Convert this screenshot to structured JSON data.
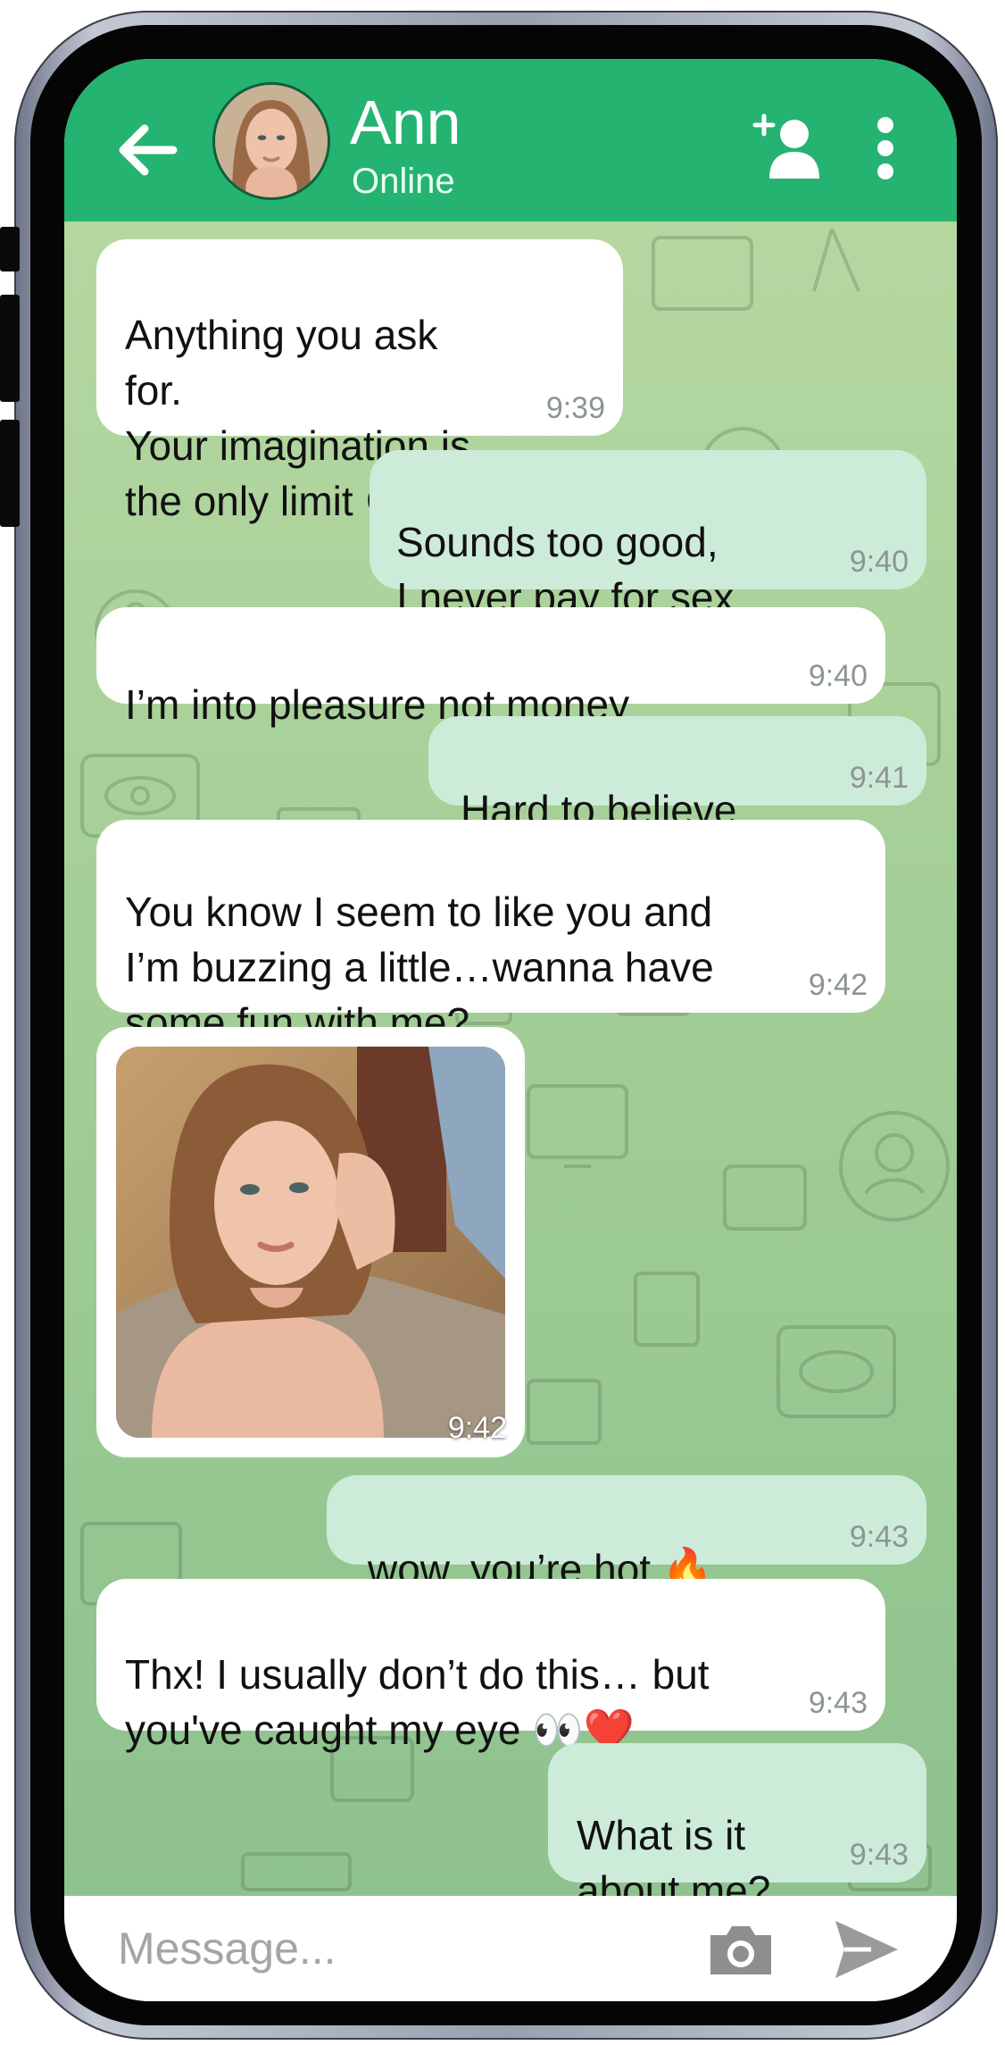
{
  "header": {
    "contact_name": "Ann",
    "status": "Online",
    "back_icon": "back-arrow-icon",
    "add_contact_icon": "add-contact-icon",
    "more_icon": "more-vertical-icon"
  },
  "messages": [
    {
      "direction": "in",
      "text": "Anything you ask for.\nYour imagination is\nthe only limit 😉",
      "time": "9:39"
    },
    {
      "direction": "out",
      "text": "Sounds too good,\nI never pay for sex",
      "time": "9:40"
    },
    {
      "direction": "in",
      "text": "I’m into pleasure not money",
      "time": "9:40"
    },
    {
      "direction": "out",
      "text": "Hard to believe",
      "time": "9:41"
    },
    {
      "direction": "in",
      "text": "You know I seem to like you and\nI’m buzzing a little…wanna have\nsome fun with me?",
      "time": "9:42"
    },
    {
      "direction": "in",
      "type": "photo",
      "time": "9:42"
    },
    {
      "direction": "out",
      "text": "wow, you’re hot 🔥",
      "time": "9:43"
    },
    {
      "direction": "in",
      "text": "Thx! I usually don’t do this… but\nyou've caught my eye 👀❤️",
      "time": "9:43"
    },
    {
      "direction": "out",
      "text": "What is it\nabout me?",
      "time": "9:43"
    }
  ],
  "composer": {
    "placeholder": "Message...",
    "camera_icon": "camera-icon",
    "send_icon": "send-icon"
  },
  "colors": {
    "header_green": "#24b371",
    "incoming_bubble": "#ffffff",
    "outgoing_bubble": "#cdebd9",
    "timestamp": "#8c9690"
  }
}
